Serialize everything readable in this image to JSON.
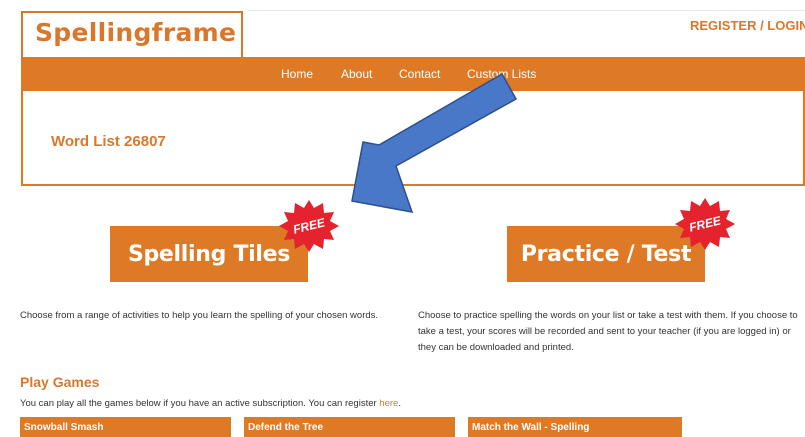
{
  "header": {
    "logo_text": "Spellingframe",
    "register_login": "REGISTER  /  LOGIN"
  },
  "nav": {
    "items": [
      "Home",
      "About",
      "Contact",
      "Custom Lists"
    ]
  },
  "panel": {
    "title": "Word List 26807"
  },
  "activities": {
    "tiles": {
      "label": "Spelling Tiles",
      "badge": "FREE",
      "description": "Choose from a range of activities to help you learn the spelling of your chosen words."
    },
    "practice": {
      "label": "Practice / Test",
      "badge": "FREE",
      "description": "Choose to practice spelling the words on your list or take a test with them. If you choose to take a test, your scores will be recorded and sent to your teacher (if you are logged in) or they can be downloaded and printed."
    }
  },
  "games": {
    "title": "Play Games",
    "subtitle_text": "You can play all the games below if you have an active subscription. You can register ",
    "subtitle_link": "here",
    "subtitle_end": ".",
    "items": [
      "Snowball Smash",
      "Defend the Tree",
      "Match the Wall - Spelling"
    ]
  },
  "colors": {
    "brand_orange": "#de7a26",
    "arrow_blue": "#4a78c8"
  }
}
